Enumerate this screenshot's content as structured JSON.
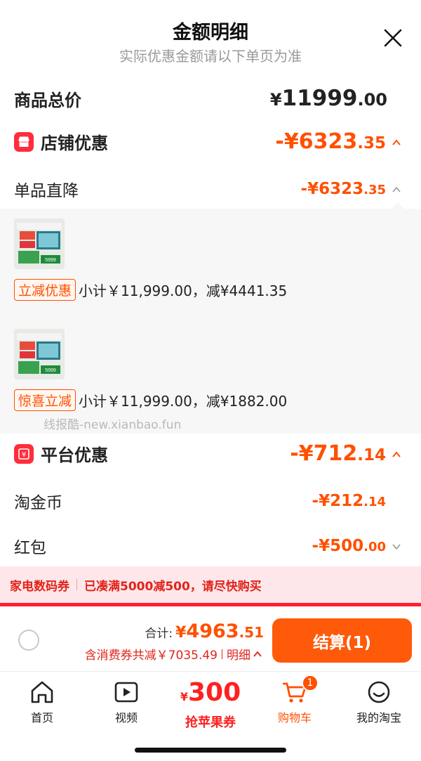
{
  "header": {
    "title": "金额明细",
    "subtitle": "实际优惠金额请以下单页为准"
  },
  "summary": {
    "total_price_label": "商品总价",
    "total_price_symbol": "¥",
    "total_price_int": "11999",
    "total_price_dec": ".00"
  },
  "shop_discount": {
    "label": "店铺优惠",
    "amount_prefix": "-¥",
    "amount_int": "6323",
    "amount_dec": ".35",
    "sub_label": "单品直降",
    "sub_amount_prefix": "-¥",
    "sub_amount_int": "6323",
    "sub_amount_dec": ".35"
  },
  "items": [
    {
      "tag": "立减优惠",
      "text": "小计￥11,999.00，减¥4441.35",
      "thumb_price": "5999"
    },
    {
      "tag": "惊喜立减",
      "text": "小计￥11,999.00，减¥1882.00",
      "thumb_price": "5999"
    }
  ],
  "watermark": "线报酷-new.xianbao.fun",
  "platform_discount": {
    "label": "平台优惠",
    "amount_prefix": "-¥",
    "amount_int": "712",
    "amount_dec": ".14",
    "rows": [
      {
        "label": "淘金币",
        "prefix": "-¥",
        "int": "212",
        "dec": ".14"
      },
      {
        "label": "红包",
        "prefix": "-¥",
        "int": "500",
        "dec": ".00"
      }
    ]
  },
  "coupon": {
    "name": "家电数码券",
    "message": "已凑满5000减500，请尽快购买"
  },
  "checkout": {
    "total_label": "合计:",
    "total_symbol": "¥",
    "total_int": "4963",
    "total_dec": ".51",
    "savings_text": "含消费券共减￥7035.49",
    "detail_link": "明细",
    "pay_button": "结算(1)"
  },
  "tabbar": {
    "home": "首页",
    "video": "视频",
    "promo_symbol": "¥",
    "promo_amount": "300",
    "promo_label": "抢苹果券",
    "cart": "购物车",
    "cart_badge": "1",
    "mine": "我的淘宝"
  },
  "colors": {
    "accent": "#ff5000",
    "red": "#ff2d3c",
    "coupon_bg": "#fde7ea"
  }
}
